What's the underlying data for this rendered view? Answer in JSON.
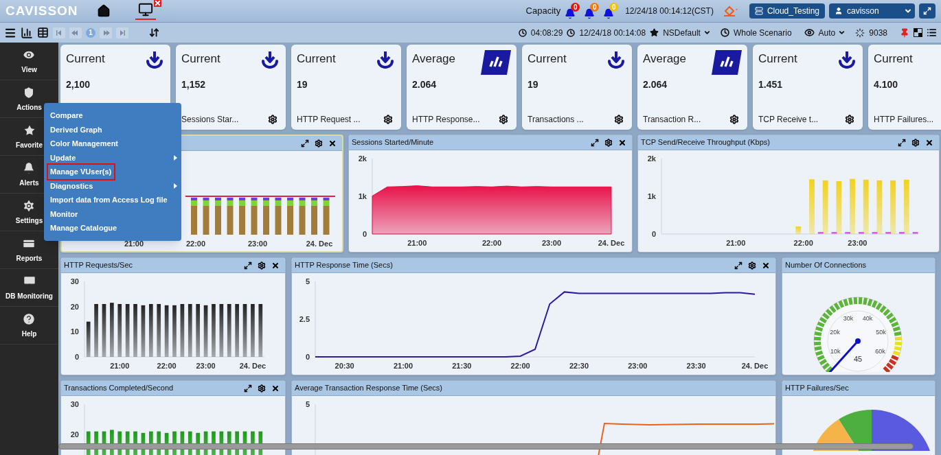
{
  "header": {
    "logo": "CAVISSON",
    "capacity_label": "Capacity",
    "alerts": [
      {
        "count": "0",
        "color": "#e8130e"
      },
      {
        "count": "0",
        "color": "#f07a0f"
      },
      {
        "count": "0",
        "color": "#f2c200"
      }
    ],
    "datetime": "12/24/18 00:14:12(CST)",
    "project_button": "Cloud_Testing",
    "user_button": "cavisson"
  },
  "toolbar": {
    "page": "1",
    "elapsed": "04:08:29",
    "timestamp": "12/24/18 00:14:08",
    "favorite": "NSDefault",
    "scenario": "Whole Scenario",
    "view_mode": "Auto",
    "count": "9038"
  },
  "sidebar": {
    "items": [
      {
        "label": "View"
      },
      {
        "label": "Actions"
      },
      {
        "label": "Favorite"
      },
      {
        "label": "Alerts"
      },
      {
        "label": "Settings"
      },
      {
        "label": "Reports"
      },
      {
        "label": "DB Monitoring"
      },
      {
        "label": "Help"
      }
    ]
  },
  "actions_menu": {
    "items": [
      {
        "label": "Compare",
        "submenu": false,
        "selected": false
      },
      {
        "label": "Derived Graph",
        "submenu": false,
        "selected": false
      },
      {
        "label": "Color Management",
        "submenu": false,
        "selected": false
      },
      {
        "label": "Update",
        "submenu": true,
        "selected": false
      },
      {
        "label": "Manage VUser(s)",
        "submenu": false,
        "selected": true
      },
      {
        "label": "Diagnostics",
        "submenu": true,
        "selected": false
      },
      {
        "label": "Import data from Access Log file",
        "submenu": false,
        "selected": false
      },
      {
        "label": "Monitor",
        "submenu": false,
        "selected": false
      },
      {
        "label": "Manage Catalogue",
        "submenu": false,
        "selected": false
      }
    ]
  },
  "cards": [
    {
      "label": "Current",
      "value": "2,100",
      "kind": "current"
    },
    {
      "label": "Current",
      "value": "1,152",
      "caption": "Sessions Star...",
      "kind": "current"
    },
    {
      "label": "Current",
      "value": "19",
      "caption": "HTTP Request ...",
      "kind": "current"
    },
    {
      "label": "Average",
      "value": "2.064",
      "caption": "HTTP Response...",
      "kind": "average"
    },
    {
      "label": "Current",
      "value": "19",
      "caption": "Transactions ...",
      "kind": "current"
    },
    {
      "label": "Average",
      "value": "2.064",
      "caption": "Transaction R...",
      "kind": "average"
    },
    {
      "label": "Current",
      "value": "1.451",
      "caption": "TCP Receive t...",
      "kind": "current"
    },
    {
      "label": "Current",
      "value": "4.100",
      "caption": "HTTP Failures...",
      "kind": "current"
    }
  ],
  "panels": [
    {
      "kind": "stacked",
      "x_labels": [
        "21:00",
        "22:00",
        "23:00",
        "24. Dec"
      ]
    },
    {
      "title": "Sessions Started/Minute",
      "kind": "chart",
      "chart_data": {
        "type": "area",
        "ylim": [
          0,
          2000
        ],
        "yticks": [
          {
            "value": 0,
            "label": "0"
          },
          {
            "value": 1000,
            "label": "1k"
          },
          {
            "value": 2000,
            "label": "2k"
          }
        ],
        "categories": [
          null,
          null,
          null,
          "21:00",
          null,
          null,
          null,
          null,
          "22:00",
          null,
          null,
          null,
          "23:00",
          null,
          null,
          null,
          "24. Dec"
        ],
        "series": [
          {
            "color": "#e8124a",
            "values": [
              1010,
              1250,
              1260,
              1280,
              1250,
              1250,
              1250,
              1260,
              1250,
              1270,
              1250,
              1260,
              1250,
              1250,
              1250,
              1250,
              1250
            ]
          }
        ]
      }
    },
    {
      "title": "TCP Send/Receive Throughput (Kbps)",
      "kind": "chart",
      "chart_data": {
        "type": "bar",
        "ylim": [
          0,
          2000
        ],
        "yticks": [
          {
            "value": 0,
            "label": "0"
          },
          {
            "value": 1000,
            "label": "1k"
          },
          {
            "value": 2000,
            "label": "2k"
          }
        ],
        "categories": [
          null,
          null,
          null,
          null,
          null,
          "21:00",
          null,
          null,
          null,
          null,
          "22:00",
          null,
          null,
          null,
          "23:00",
          null,
          null,
          null,
          null
        ],
        "series": [
          {
            "color": "#f2d21f",
            "values": [
              null,
              null,
              null,
              null,
              null,
              null,
              null,
              null,
              null,
              null,
              200,
              1450,
              1420,
              1400,
              1460,
              1440,
              1420,
              1420,
              1440
            ]
          },
          {
            "color": "#d21fe0",
            "values": [
              null,
              null,
              null,
              null,
              null,
              null,
              null,
              null,
              null,
              null,
              null,
              50,
              50,
              50,
              50,
              50,
              50,
              50,
              50
            ]
          }
        ]
      }
    },
    {
      "title": "HTTP Requests/Sec",
      "kind": "chart",
      "chart_data": {
        "type": "bar",
        "ylim": [
          0,
          30
        ],
        "yticks": [
          0,
          10,
          20,
          30
        ],
        "categories": [
          null,
          null,
          null,
          null,
          "21:00",
          null,
          null,
          null,
          null,
          null,
          "22:00",
          null,
          null,
          null,
          null,
          "23:00",
          null,
          null,
          null,
          null,
          null,
          "24. Dec",
          null
        ],
        "series": [
          {
            "color": "#222222",
            "values": [
              14,
              21,
              21,
              21.5,
              21,
              21,
              21,
              20.5,
              21,
              21,
              20.5,
              20.5,
              21,
              21,
              21,
              20.5,
              21,
              21,
              21,
              21,
              21,
              21,
              21
            ]
          }
        ]
      }
    },
    {
      "title": "HTTP Response Time (Secs)",
      "kind": "chart",
      "chart_data": {
        "type": "line",
        "ylim": [
          0,
          5
        ],
        "yticks": [
          0,
          2.5,
          5
        ],
        "categories": [
          null,
          null,
          "20:30",
          null,
          null,
          null,
          "21:00",
          null,
          null,
          null,
          "21:30",
          null,
          null,
          null,
          "22:00",
          null,
          null,
          null,
          "22:30",
          null,
          null,
          null,
          "23:00",
          null,
          null,
          null,
          "23:30",
          null,
          null,
          null,
          "24. Dec"
        ],
        "series": [
          {
            "color": "#2a1aa0",
            "values": [
              0,
              0,
              0,
              0,
              0,
              0,
              0,
              0,
              0,
              0,
              0,
              0,
              0,
              0,
              0.05,
              0.5,
              3.5,
              4.3,
              4.2,
              4.2,
              4.2,
              4.2,
              4.2,
              4.2,
              4.2,
              4.2,
              4.2,
              4.2,
              4.25,
              4.25,
              4.15
            ]
          }
        ]
      }
    },
    {
      "title": "Number Of Connections",
      "kind": "gauge",
      "scale_labels": [
        "10k",
        "20k",
        "30k",
        "40k",
        "50k",
        "60k"
      ],
      "reading": "45"
    },
    {
      "title": "Transactions Completed/Second",
      "kind": "chart",
      "chart_data": {
        "type": "bar",
        "ylim": [
          0,
          30
        ],
        "yticks": [
          20,
          30
        ],
        "series": [
          {
            "color": "#1f9a1a",
            "values": [
              21,
              21,
              21,
              21.5,
              21,
              21,
              21,
              20.5,
              21,
              21,
              20.5,
              21,
              21,
              21,
              20.5,
              21,
              21,
              21,
              21,
              21,
              21,
              21,
              21
            ]
          }
        ]
      }
    },
    {
      "title": "Average Transaction Response Time (Secs)",
      "kind": "trend",
      "axis_label": "5"
    },
    {
      "title": "HTTP Failures/Sec",
      "kind": "pie"
    }
  ]
}
